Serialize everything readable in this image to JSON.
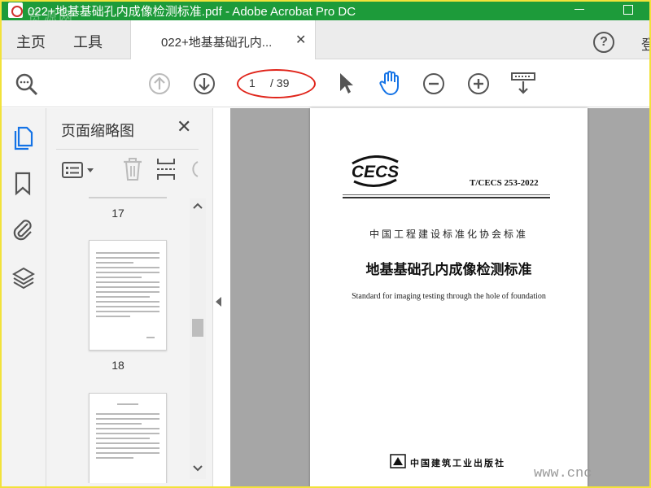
{
  "window": {
    "title": "022+地基基础孔内成像检测标准.pdf - Adobe Acrobat Pro DC",
    "watermark_tl": "资源网"
  },
  "menu": {
    "home": "主页",
    "tools": "工具",
    "tab_title": "022+地基基础孔内...",
    "tab_close": "✕",
    "help": "?",
    "cut_label": "登"
  },
  "toolbar": {
    "current_page": "1",
    "total_pages": "/ 39"
  },
  "panel": {
    "title": "页面缩略图",
    "close": "✕",
    "thumb_labels": [
      "17",
      "18"
    ]
  },
  "document": {
    "std_number": "T/CECS 253-2022",
    "association": "中国工程建设标准化协会标准",
    "title_cn": "地基基础孔内成像检测标准",
    "title_en": "Standard for imaging testing through the hole of foundation",
    "publisher": "中国建筑工业出版社",
    "logo_text": "CECS"
  },
  "watermark_url": "www.cnc",
  "colors": {
    "titlebar": "#1d9b3a",
    "accent_blue": "#1473e6",
    "annotation_red": "#e0251b"
  }
}
